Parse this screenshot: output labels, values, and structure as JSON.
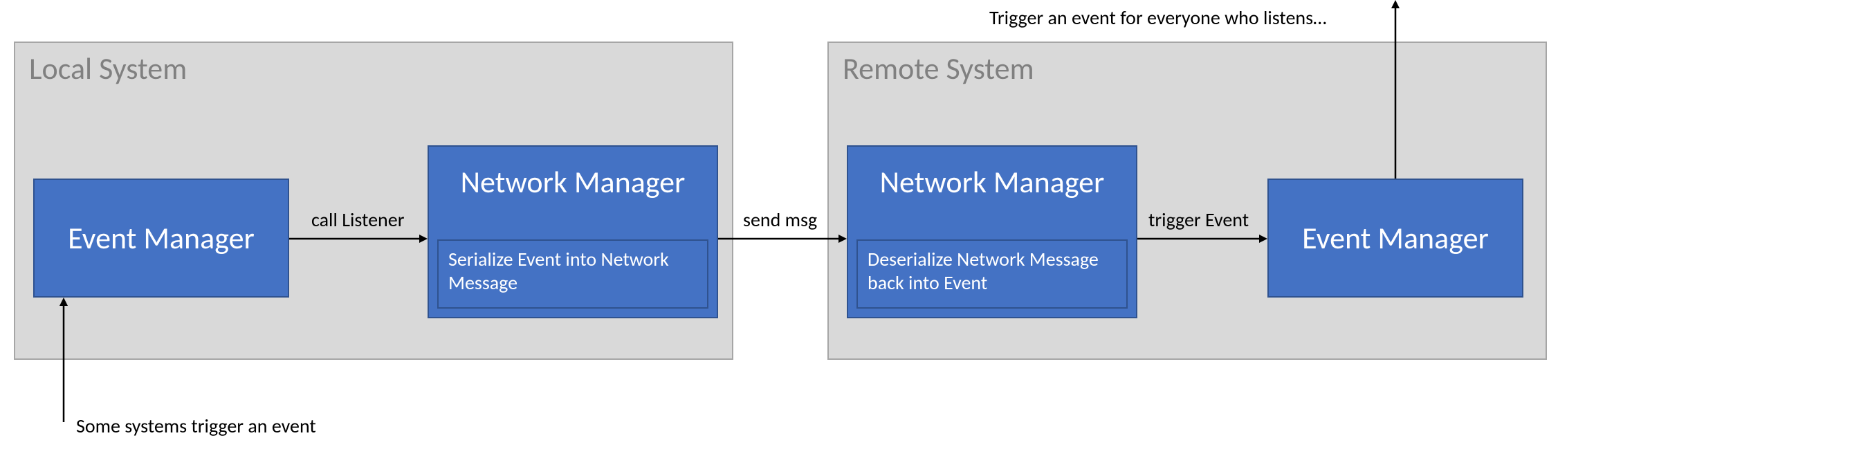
{
  "local": {
    "title": "Local System",
    "eventManager": "Event Manager",
    "networkManager": "Network Manager",
    "serializeNote": "Serialize Event into Network Message"
  },
  "remote": {
    "title": "Remote System",
    "networkManager": "Network Manager",
    "deserializeNote": "Deserialize Network Message back into Event",
    "eventManager": "Event Manager"
  },
  "arrows": {
    "callListener": "call Listener",
    "sendMsg": "send msg",
    "triggerEvent": "trigger Event"
  },
  "annotations": {
    "bottom": "Some systems trigger an event",
    "top": "Trigger an event for everyone who listens…"
  }
}
